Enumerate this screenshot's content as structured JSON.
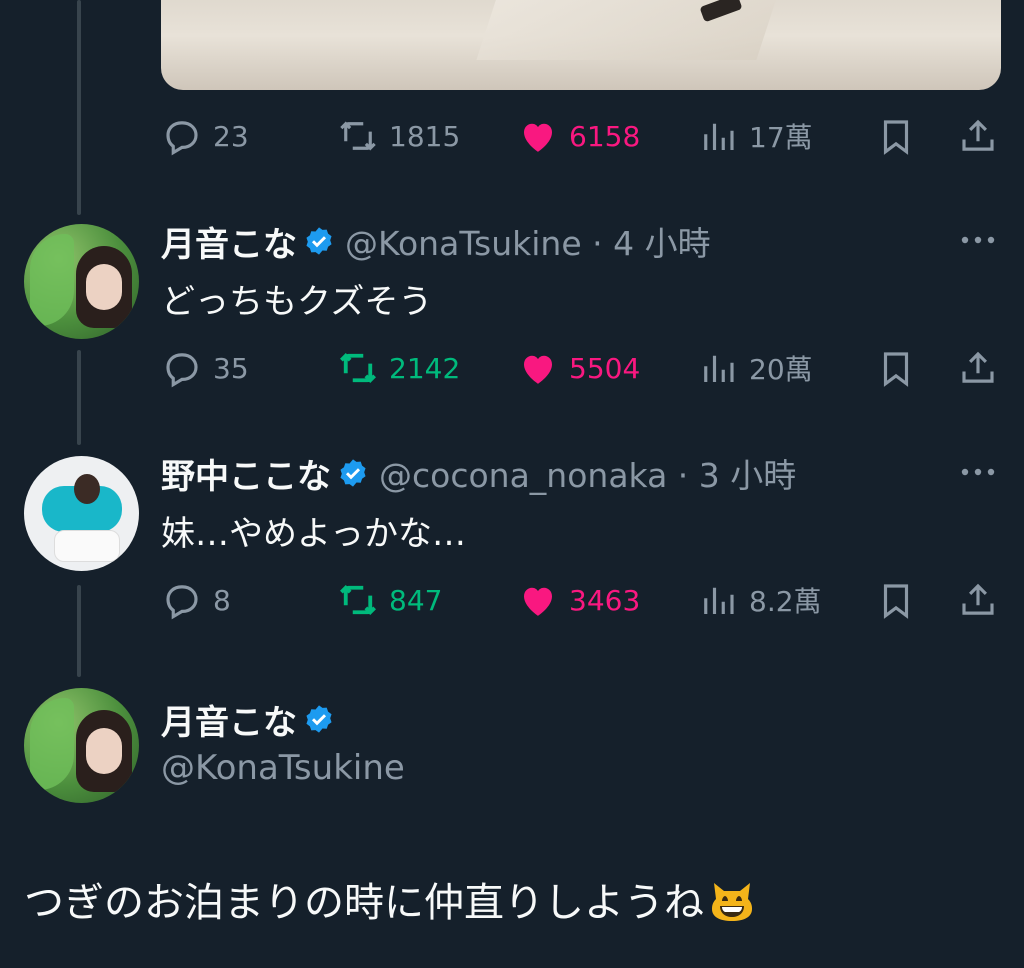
{
  "colors": {
    "background": "#15202b",
    "text_primary": "#f7f9f9",
    "text_secondary": "#8b98a5",
    "retweet_active": "#00ba7c",
    "like_active": "#f91880",
    "verified": "#1d9bf0",
    "thread_line": "#38444d"
  },
  "top_tweet": {
    "actions": {
      "reply_count": "23",
      "retweet_count": "1815",
      "like_count": "6158",
      "view_count": "17萬"
    }
  },
  "reply1": {
    "name": "月音こな",
    "handle_time": "@KonaTsukine · 4 小時",
    "text": "どっちもクズそう",
    "actions": {
      "reply_count": "35",
      "retweet_count": "2142",
      "like_count": "5504",
      "view_count": "20萬"
    }
  },
  "reply2": {
    "name": "野中ここな",
    "handle_time": "@cocona_nonaka · 3 小時",
    "text": "妹…やめよっかな…",
    "actions": {
      "reply_count": "8",
      "retweet_count": "847",
      "like_count": "3463",
      "view_count": "8.2萬"
    }
  },
  "main_tweet": {
    "name": "月音こな",
    "handle": "@KonaTsukine",
    "text": "つぎのお泊まりの時に仲直りしようね"
  },
  "icons": [
    "reply-icon",
    "retweet-icon",
    "like-icon",
    "views-icon",
    "bookmark-icon",
    "share-icon",
    "more-icon",
    "verified-icon",
    "grinning-cat-emoji"
  ]
}
